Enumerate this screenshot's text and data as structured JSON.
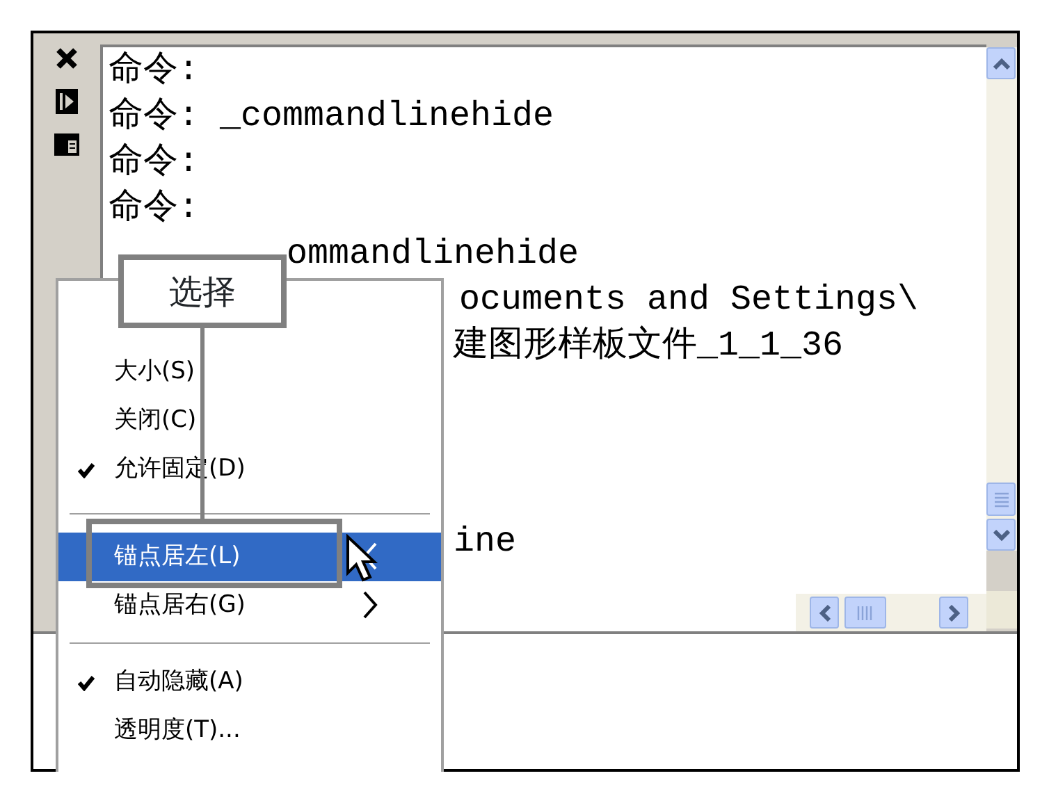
{
  "command_window": {
    "lines": [
      {
        "text": "命令:"
      },
      {
        "text": "命令: _commandlinehide"
      },
      {
        "text": "命令:"
      },
      {
        "text": "命令:"
      },
      {
        "text": "ommandlinehide"
      },
      {
        "text": "ocuments and Settings\\"
      },
      {
        "text": "建图形样板文件_1_1_36"
      },
      {
        "text": "ine"
      }
    ]
  },
  "context_menu": {
    "items": [
      {
        "kind": "item",
        "label": "大小(S)",
        "checked": false,
        "selected": false
      },
      {
        "kind": "item",
        "label": "关闭(C)",
        "checked": false,
        "selected": false
      },
      {
        "kind": "item",
        "label": "允许固定(D)",
        "checked": true,
        "selected": false
      },
      {
        "kind": "separator"
      },
      {
        "kind": "item",
        "label": "锚点居左(L)",
        "checked": false,
        "selected": true
      },
      {
        "kind": "item",
        "label": "锚点居右(G)",
        "checked": false,
        "selected": false
      },
      {
        "kind": "separator"
      },
      {
        "kind": "item",
        "label": "自动隐藏(A)",
        "checked": true,
        "selected": false
      },
      {
        "kind": "item",
        "label": "透明度(T)...",
        "checked": false,
        "selected": false
      }
    ]
  },
  "callout": {
    "label": "选择"
  }
}
